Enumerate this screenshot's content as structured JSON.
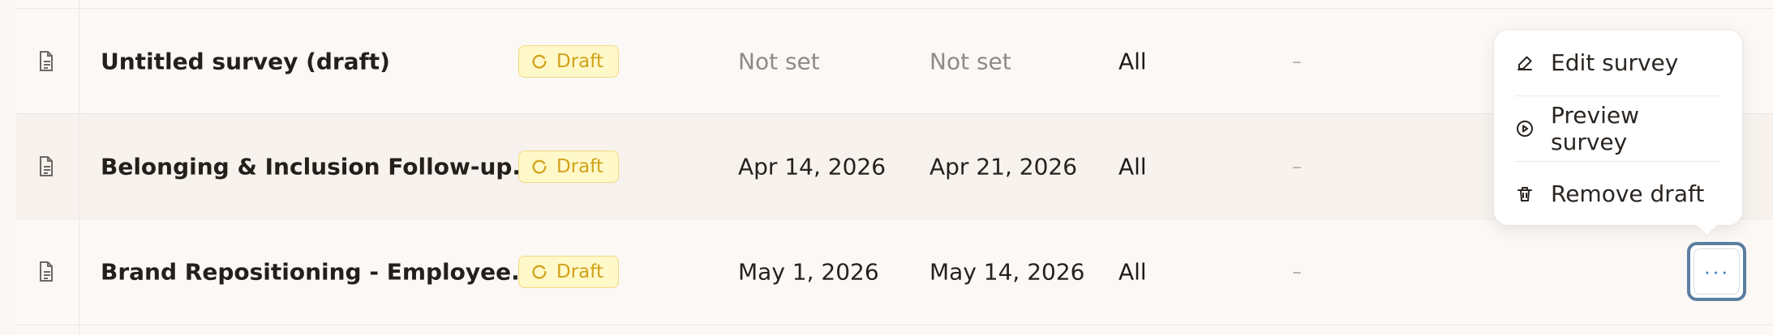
{
  "rows": [
    {
      "title": "Untitled survey (draft)",
      "status": "Draft",
      "start_date": "Not set",
      "end_date": "Not set",
      "audience": "All",
      "responses": "–"
    },
    {
      "title": "Belonging & Inclusion Follow-up...",
      "status": "Draft",
      "start_date": "Apr 14, 2026",
      "end_date": "Apr 21, 2026",
      "audience": "All",
      "responses": "–"
    },
    {
      "title": "Brand Repositioning - Employee...",
      "status": "Draft",
      "start_date": "May 1, 2026",
      "end_date": "May 14, 2026",
      "audience": "All",
      "responses": "–"
    }
  ],
  "menu": {
    "items": [
      {
        "label": "Edit survey",
        "icon": "pencil-icon"
      },
      {
        "label": "Preview survey",
        "icon": "play-circle-icon"
      },
      {
        "label": "Remove draft",
        "icon": "trash-icon"
      }
    ]
  },
  "more_button": {
    "label": "···"
  },
  "colors": {
    "background": "#fbf8f5",
    "draft_badge_bg": "#fff8c9",
    "draft_badge_border": "#f3d97b",
    "draft_badge_text": "#d1a21a",
    "focus_ring": "#5b7ea1",
    "action_blue": "#2f78c4"
  },
  "icons": {
    "row_document": "document-icon",
    "draft_status": "draft-status-icon",
    "more": "ellipsis-icon"
  }
}
